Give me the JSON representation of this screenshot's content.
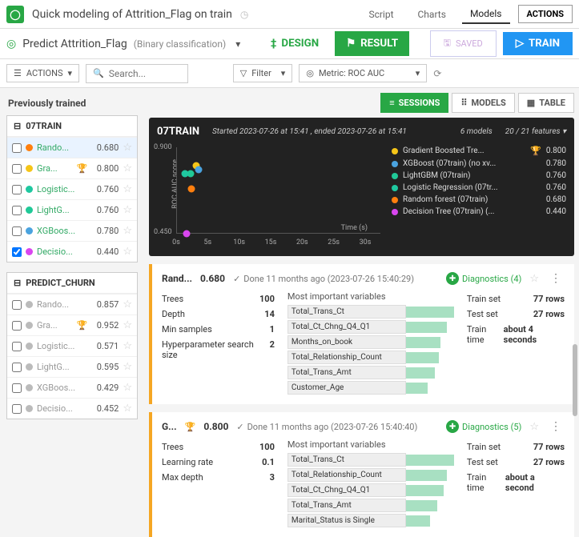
{
  "topbar": {
    "title": "Quick modeling of Attrition_Flag on train",
    "tabs": [
      "Script",
      "Charts",
      "Models"
    ],
    "actions": "ACTIONS"
  },
  "secondbar": {
    "predict_label": "Predict Attrition_Flag",
    "predict_type": "(Binary classification)",
    "design": "DESIGN",
    "result": "RESULT",
    "saved": "SAVED",
    "train": "TRAIN"
  },
  "filterbar": {
    "actions": "ACTIONS",
    "search_placeholder": "Search...",
    "filter": "Filter",
    "metric": "Metric: ROC AUC"
  },
  "left": {
    "prev": "Previously trained",
    "sessions": [
      {
        "name": "07TRAIN",
        "models": [
          {
            "color": "#ff7f0e",
            "name": "Rando...",
            "score": "0.680",
            "trophy": false,
            "selected": true,
            "checked": false
          },
          {
            "color": "#f5c518",
            "name": "Gra...",
            "score": "0.800",
            "trophy": true,
            "selected": false,
            "checked": false
          },
          {
            "color": "#1fc8a0",
            "name": "Logistic...",
            "score": "0.760",
            "trophy": false,
            "selected": false,
            "checked": false
          },
          {
            "color": "#20c997",
            "name": "LightG...",
            "score": "0.760",
            "trophy": false,
            "selected": false,
            "checked": false
          },
          {
            "color": "#4aa3df",
            "name": "XGBoos...",
            "score": "0.780",
            "trophy": false,
            "selected": false,
            "checked": false
          },
          {
            "color": "#d946ef",
            "name": "Decisio...",
            "score": "0.440",
            "trophy": false,
            "selected": false,
            "checked": true
          }
        ]
      },
      {
        "name": "PREDICT_CHURN",
        "models": [
          {
            "color": "#bbb",
            "name": "Rando...",
            "score": "0.857",
            "trophy": false,
            "grey": true
          },
          {
            "color": "#bbb",
            "name": "Gra...",
            "score": "0.952",
            "trophy": true,
            "grey": true
          },
          {
            "color": "#bbb",
            "name": "Logistic...",
            "score": "0.571",
            "trophy": false,
            "grey": true
          },
          {
            "color": "#bbb",
            "name": "LightG...",
            "score": "0.595",
            "trophy": false,
            "grey": true
          },
          {
            "color": "#bbb",
            "name": "XGBoos...",
            "score": "0.429",
            "trophy": false,
            "grey": true
          },
          {
            "color": "#bbb",
            "name": "Decisio...",
            "score": "0.452",
            "trophy": false,
            "grey": true
          }
        ]
      }
    ]
  },
  "viewtabs": {
    "sessions": "SESSIONS",
    "models": "MODELS",
    "table": "TABLE"
  },
  "chart": {
    "session": "07TRAIN",
    "meta": "Started 2023-07-26 at 15:41 , ended 2023-07-26 at 15:41",
    "nmodels": "6 models",
    "features": "20 / 21 features",
    "ylabel": "ROC AUC score",
    "xlabel": "Time (s)",
    "legend": [
      {
        "color": "#f5c518",
        "name": "Gradient Boosted Tre...",
        "score": "0.800",
        "trophy": true
      },
      {
        "color": "#4aa3df",
        "name": "XGBoost (07train) (no xv...",
        "score": "0.780",
        "trophy": false
      },
      {
        "color": "#20c997",
        "name": "LightGBM (07train)",
        "score": "0.760",
        "trophy": false
      },
      {
        "color": "#1fc8a0",
        "name": "Logistic Regression (07tr...",
        "score": "0.760",
        "trophy": false
      },
      {
        "color": "#ff7f0e",
        "name": "Random forest (07train)",
        "score": "0.680",
        "trophy": false
      },
      {
        "color": "#d946ef",
        "name": "Decision Tree (07train) (...",
        "score": "0.440",
        "trophy": false
      }
    ]
  },
  "chart_data": {
    "type": "scatter",
    "title": "",
    "xlabel": "Time (s)",
    "ylabel": "ROC AUC score",
    "xlim": [
      0,
      30
    ],
    "ylim": [
      0.44,
      0.9
    ],
    "xticks": [
      0,
      5,
      10,
      15,
      20,
      25,
      30
    ],
    "yticks": [
      0.45,
      0.9
    ],
    "series": [
      {
        "name": "Gradient Boosted Trees",
        "color": "#f5c518",
        "x": [
          3.2
        ],
        "y": [
          0.8
        ]
      },
      {
        "name": "XGBoost",
        "color": "#4aa3df",
        "x": [
          3.5
        ],
        "y": [
          0.78
        ]
      },
      {
        "name": "LightGBM",
        "color": "#20c997",
        "x": [
          2.3
        ],
        "y": [
          0.76
        ]
      },
      {
        "name": "Logistic Regression",
        "color": "#1fc8a0",
        "x": [
          1.4
        ],
        "y": [
          0.76
        ]
      },
      {
        "name": "Random forest",
        "color": "#ff7f0e",
        "x": [
          2.4
        ],
        "y": [
          0.68
        ]
      },
      {
        "name": "Decision Tree",
        "color": "#d946ef",
        "x": [
          1.6
        ],
        "y": [
          0.44
        ]
      }
    ]
  },
  "cards": [
    {
      "name": "Rand...",
      "trophy": false,
      "score": "0.680",
      "done": "Done 11 months ago (2023-07-26 15:40:29)",
      "diag": "Diagnostics (4)",
      "params": [
        {
          "k": "Trees",
          "v": "100"
        },
        {
          "k": "Depth",
          "v": "14"
        },
        {
          "k": "Min samples",
          "v": "1"
        },
        {
          "k": "Hyperparameter search size",
          "v": "2"
        }
      ],
      "vars_title": "Most important variables",
      "vars": [
        {
          "name": "Total_Trans_Ct",
          "w": 100
        },
        {
          "name": "Total_Ct_Chng_Q4_Q1",
          "w": 85
        },
        {
          "name": "Months_on_book",
          "w": 72
        },
        {
          "name": "Total_Relationship_Count",
          "w": 68
        },
        {
          "name": "Total_Trans_Amt",
          "w": 60
        },
        {
          "name": "Customer_Age",
          "w": 45
        }
      ],
      "stats": [
        {
          "k": "Train set",
          "v": "77 rows"
        },
        {
          "k": "Test set",
          "v": "27 rows"
        },
        {
          "k": "Train time",
          "v": "about 4 seconds"
        }
      ]
    },
    {
      "name": "G...",
      "trophy": true,
      "score": "0.800",
      "done": "Done 11 months ago (2023-07-26 15:40:40)",
      "diag": "Diagnostics (5)",
      "params": [
        {
          "k": "Trees",
          "v": "100"
        },
        {
          "k": "Learning rate",
          "v": "0.1"
        },
        {
          "k": "Max depth",
          "v": "3"
        }
      ],
      "vars_title": "Most important variables",
      "vars": [
        {
          "name": "Total_Trans_Ct",
          "w": 100
        },
        {
          "name": "Total_Relationship_Count",
          "w": 85
        },
        {
          "name": "Total_Ct_Chng_Q4_Q1",
          "w": 78
        },
        {
          "name": "Total_Trans_Amt",
          "w": 65
        },
        {
          "name": "Marital_Status is Single",
          "w": 50
        }
      ],
      "stats": [
        {
          "k": "Train set",
          "v": "77 rows"
        },
        {
          "k": "Test set",
          "v": "27 rows"
        },
        {
          "k": "Train time",
          "v": "about a second"
        }
      ]
    }
  ]
}
